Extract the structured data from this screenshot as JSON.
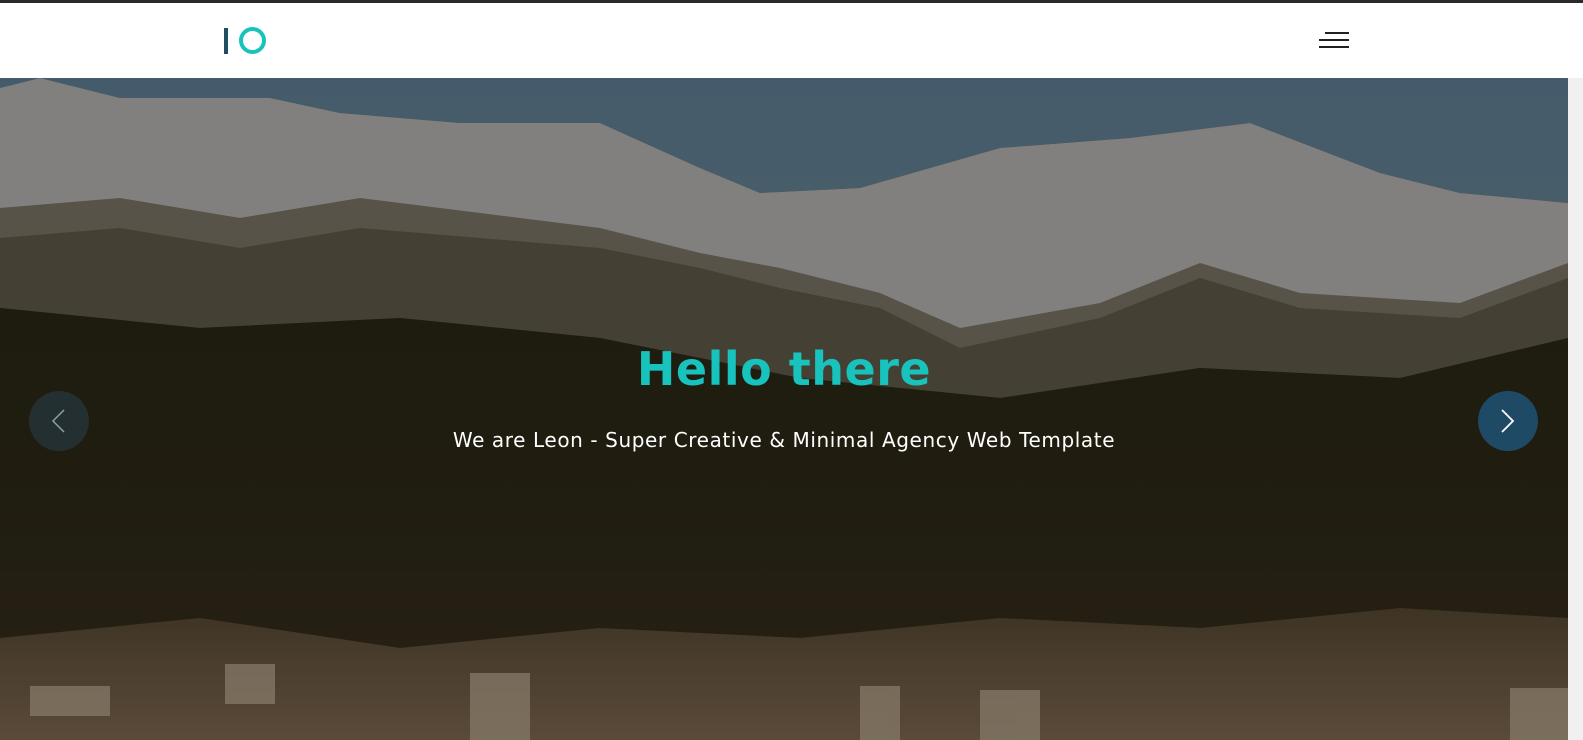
{
  "header": {
    "logo_alt": "Leon logo",
    "menu_icon": "hamburger-menu-icon"
  },
  "hero": {
    "title": "Hello there",
    "subtitle": "We are Leon - Super Creative & Minimal Agency Web Template",
    "prev_icon": "chevron-left-icon",
    "next_icon": "chevron-right-icon"
  },
  "colors": {
    "accent": "#17c3bc",
    "logo_bar": "#1f4e63",
    "arrow_active": "#1f4a66",
    "topbar": "#2a2a2a"
  }
}
